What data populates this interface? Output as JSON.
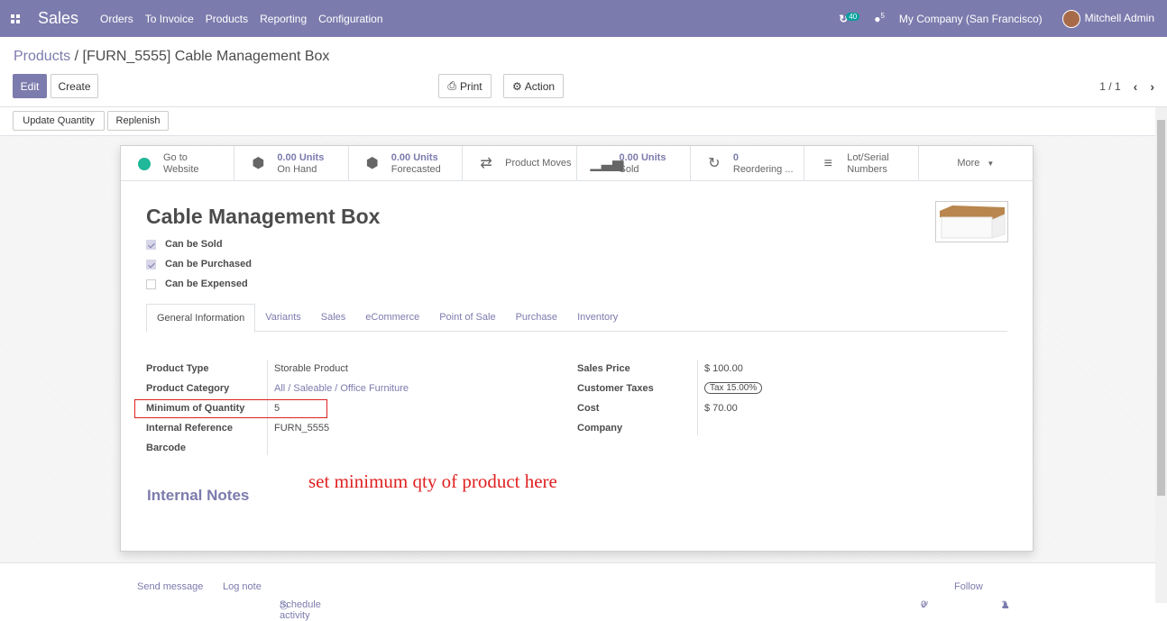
{
  "navbar": {
    "app_name": "Sales",
    "menu": [
      "Orders",
      "To Invoice",
      "Products",
      "Reporting",
      "Configuration"
    ],
    "activity_count": "40",
    "message_count": "5",
    "company": "My Company (San Francisco)",
    "user": "Mitchell Admin"
  },
  "breadcrumb": {
    "parent": "Products",
    "separator": "/",
    "current": "[FURN_5555] Cable Management Box"
  },
  "buttons": {
    "edit": "Edit",
    "create": "Create",
    "print": "Print",
    "action": "Action",
    "update_qty": "Update Quantity",
    "replenish": "Replenish"
  },
  "pager": {
    "value": "1 / 1"
  },
  "smart_buttons": [
    {
      "value": "Go to",
      "label": "Website",
      "icon": "globe-icon"
    },
    {
      "value": "0.00 Units",
      "label": "On Hand",
      "icon": "cubes-icon"
    },
    {
      "value": "0.00 Units",
      "label": "Forecasted",
      "icon": "cubes-icon"
    },
    {
      "value": "",
      "label": "Product Moves",
      "icon": "exchange-icon"
    },
    {
      "value": "0.00 Units",
      "label": "Sold",
      "icon": "signal-icon"
    },
    {
      "value": "0",
      "label": "Reordering ...",
      "icon": "refresh-icon"
    },
    {
      "value": "Lot/Serial",
      "label": "Numbers",
      "icon": "bars-icon"
    },
    {
      "value": "",
      "label": "More",
      "icon": "caret-down-icon"
    }
  ],
  "product": {
    "name": "Cable Management Box",
    "can_be_sold": "Can be Sold",
    "can_be_purchased": "Can be Purchased",
    "can_be_expensed": "Can be Expensed"
  },
  "tabs": [
    "General Information",
    "Variants",
    "Sales",
    "eCommerce",
    "Point of Sale",
    "Purchase",
    "Inventory"
  ],
  "fields_left": [
    {
      "label": "Product Type",
      "value": "Storable Product"
    },
    {
      "label": "Product Category",
      "value": "All / Saleable / Office Furniture"
    },
    {
      "label": "Minimum of Quantity",
      "value": "5"
    },
    {
      "label": "Internal Reference",
      "value": "FURN_5555"
    },
    {
      "label": "Barcode",
      "value": ""
    }
  ],
  "fields_right": [
    {
      "label": "Sales Price",
      "value": "$ 100.00"
    },
    {
      "label": "Customer Taxes",
      "value": "Tax 15.00%"
    },
    {
      "label": "Cost",
      "value": "$ 70.00"
    },
    {
      "label": "Company",
      "value": ""
    }
  ],
  "annotation": "set minimum qty of product here",
  "internal_notes": "Internal Notes",
  "chatter": {
    "send": "Send message",
    "log": "Log note",
    "schedule": "Schedule activity",
    "attachments": "0",
    "follow": "Follow",
    "followers": "1"
  }
}
